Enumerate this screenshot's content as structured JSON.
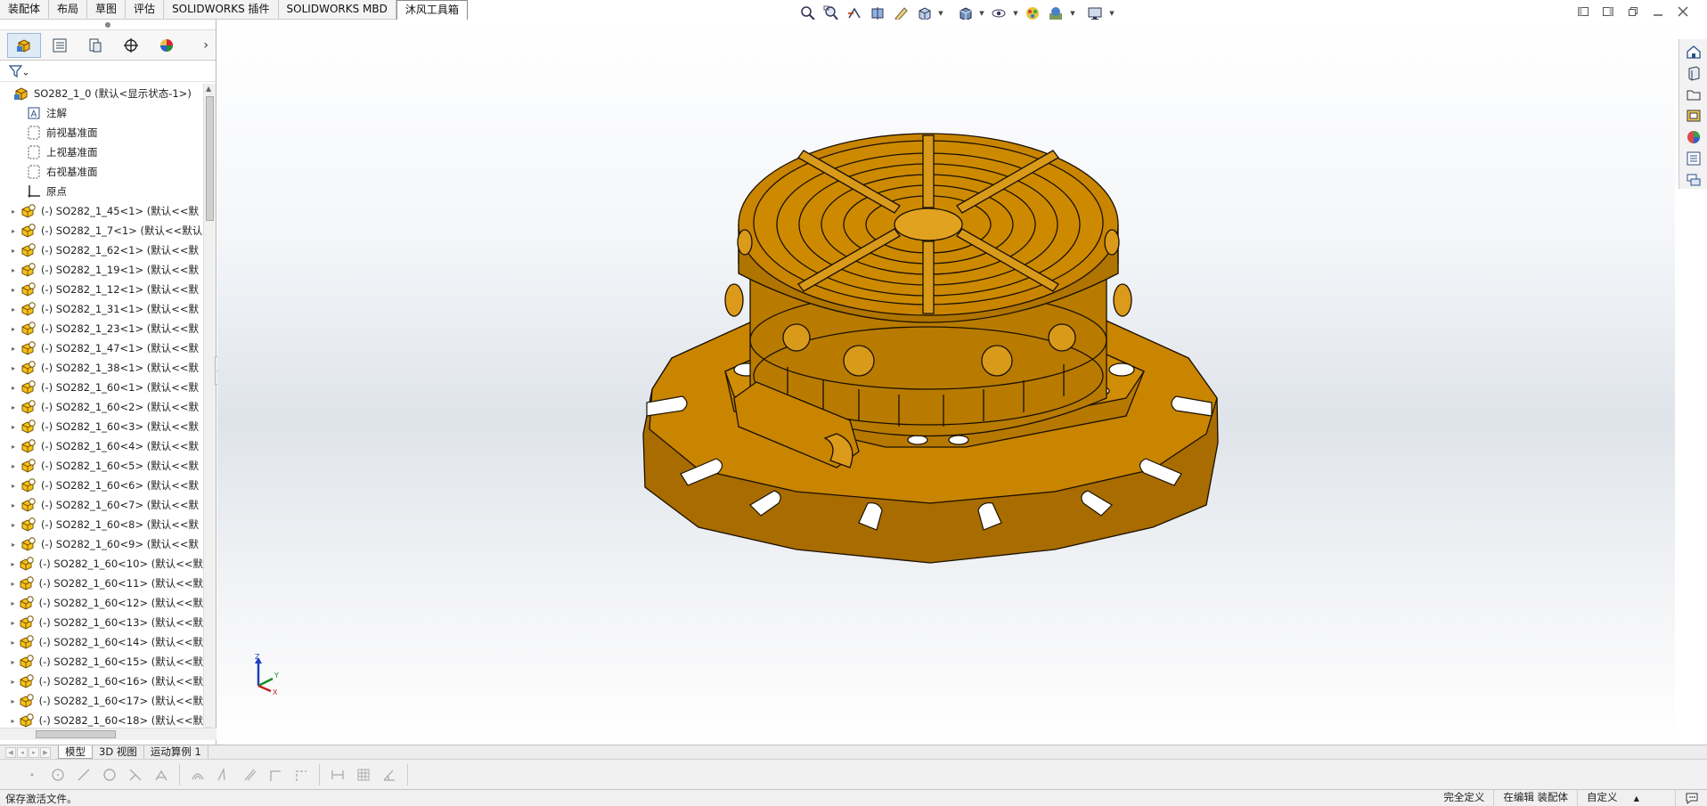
{
  "command_tabs": [
    "装配体",
    "布局",
    "草图",
    "评估",
    "SOLIDWORKS 插件",
    "SOLIDWORKS MBD",
    "沐风工具箱"
  ],
  "active_command_tab": 6,
  "feature_tree": {
    "root": "SO282_1_0  (默认<显示状态-1>)",
    "fixed_items": [
      "注解",
      "前视基准面",
      "上视基准面",
      "右视基准面",
      "原点"
    ],
    "components": [
      "(-) SO282_1_45<1> (默认<<默",
      "(-) SO282_1_7<1> (默认<<默认",
      "(-) SO282_1_62<1> (默认<<默",
      "(-) SO282_1_19<1> (默认<<默",
      "(-) SO282_1_12<1> (默认<<默",
      "(-) SO282_1_31<1> (默认<<默",
      "(-) SO282_1_23<1> (默认<<默",
      "(-) SO282_1_47<1> (默认<<默",
      "(-) SO282_1_38<1> (默认<<默",
      "(-) SO282_1_60<1> (默认<<默",
      "(-) SO282_1_60<2> (默认<<默",
      "(-) SO282_1_60<3> (默认<<默",
      "(-) SO282_1_60<4> (默认<<默",
      "(-) SO282_1_60<5> (默认<<默",
      "(-) SO282_1_60<6> (默认<<默",
      "(-) SO282_1_60<7> (默认<<默",
      "(-) SO282_1_60<8> (默认<<默",
      "(-) SO282_1_60<9> (默认<<默",
      "(-) SO282_1_60<10> (默认<<默",
      "(-) SO282_1_60<11> (默认<<默",
      "(-) SO282_1_60<12> (默认<<默",
      "(-) SO282_1_60<13> (默认<<默",
      "(-) SO282_1_60<14> (默认<<默",
      "(-) SO282_1_60<15> (默认<<默",
      "(-) SO282_1_60<16> (默认<<默",
      "(-) SO282_1_60<17> (默认<<默",
      "(-) SO282_1_60<18> (默认<<默"
    ]
  },
  "bottom_tabs": [
    "模型",
    "3D 视图",
    "运动算例 1"
  ],
  "active_bottom_tab": 0,
  "triad": {
    "z": "Z",
    "y": "Y",
    "x": "X"
  },
  "status": {
    "message": "保存激活文件。",
    "definition": "完全定义",
    "editing": "在编辑 装配体",
    "units": "自定义",
    "units_arrow": "▲"
  },
  "colors": {
    "model_top": "#c98500",
    "model_side": "#a56a00",
    "model_dark": "#8a5600",
    "model_light": "#dc9a1a"
  },
  "icons": {
    "hud": [
      "zoom-to-fit-icon",
      "zoom-area-icon",
      "previous-view-icon",
      "section-view-icon",
      "dynamic-annotation-icon",
      "view-orientation-icon",
      "display-style-icon",
      "hide-show-icon",
      "edit-appearance-icon",
      "apply-scene-icon",
      "view-settings-icon"
    ],
    "task_pane": [
      "home-icon",
      "design-library-icon",
      "file-explorer-icon",
      "view-palette-icon",
      "appearances-icon",
      "custom-properties-icon",
      "forum-icon"
    ],
    "sketch": [
      "point-icon",
      "circle-icon",
      "line-icon",
      "circle-icon",
      "trim-icon",
      "convert-icon",
      "offset-icon",
      "mirror-icon",
      "fillet-icon",
      "chamfer-icon",
      "rectangle-icon",
      "slot-icon",
      "dimension-icon",
      "grid-icon",
      "angle-icon"
    ]
  }
}
